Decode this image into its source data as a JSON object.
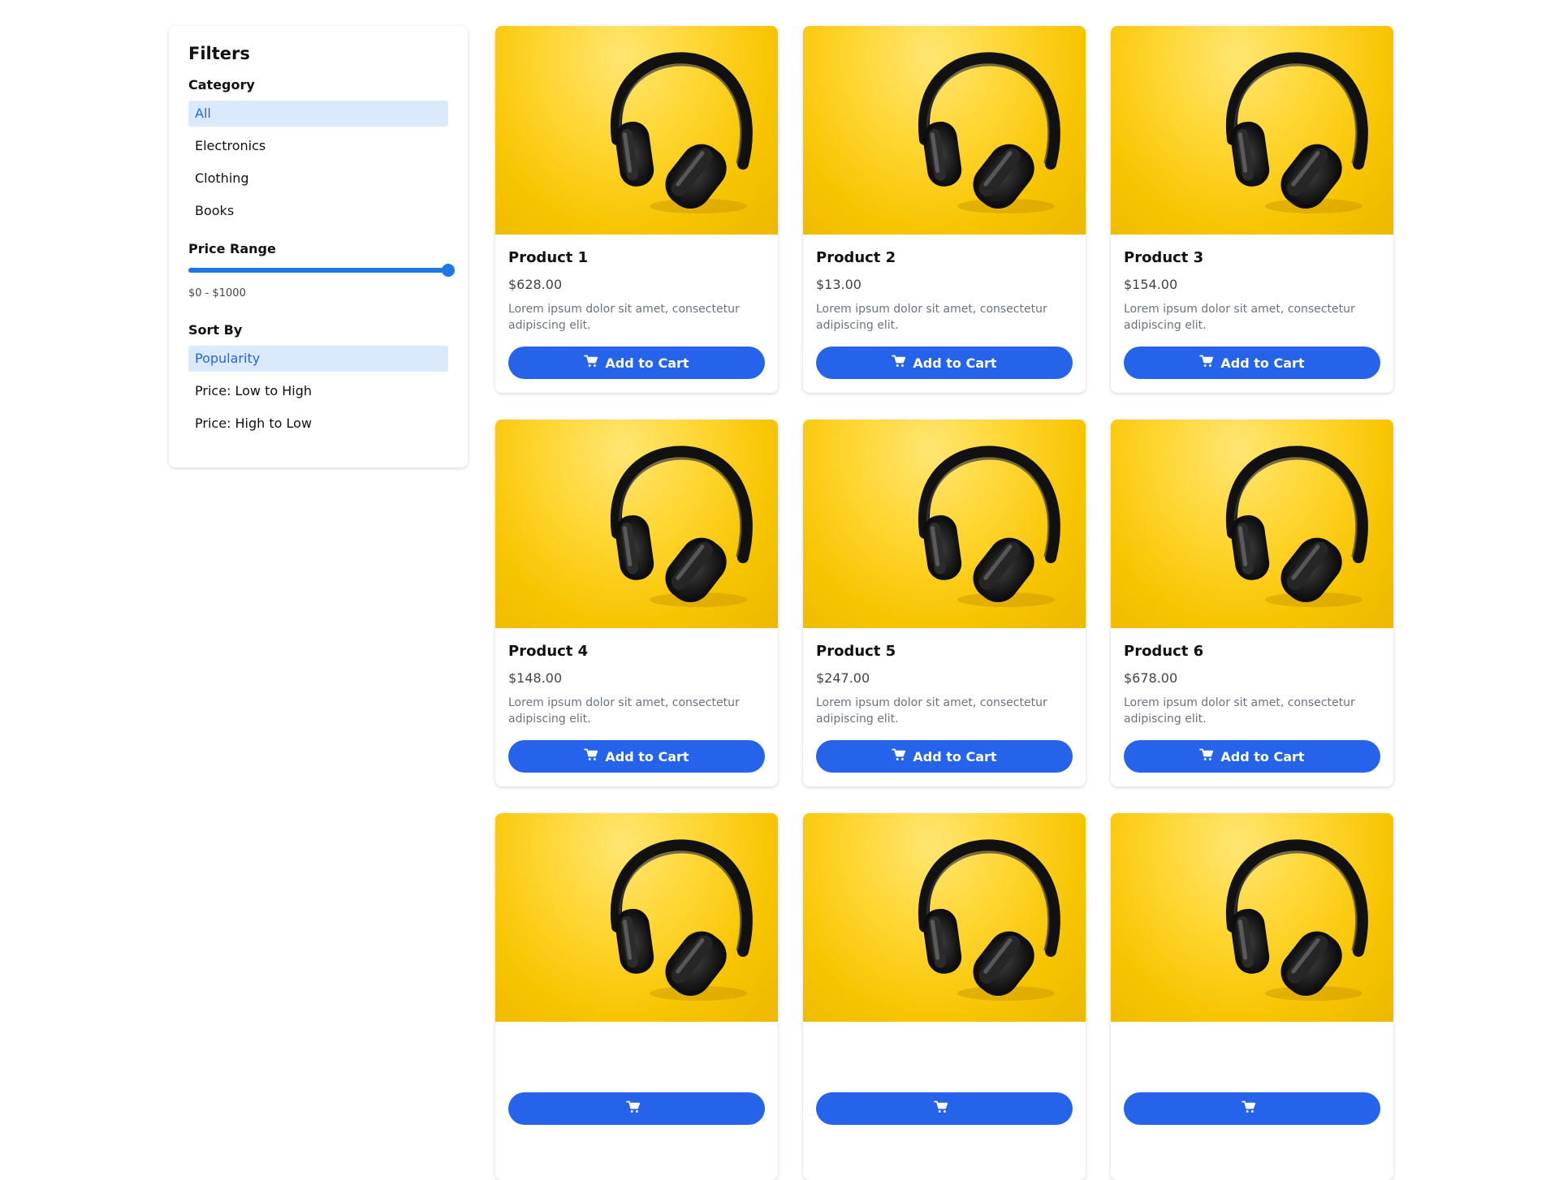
{
  "sidebar": {
    "title": "Filters",
    "category": {
      "title": "Category",
      "options": [
        {
          "label": "All",
          "active": true
        },
        {
          "label": "Electronics",
          "active": false
        },
        {
          "label": "Clothing",
          "active": false
        },
        {
          "label": "Books",
          "active": false
        }
      ]
    },
    "price": {
      "title": "Price Range",
      "min": 0,
      "max": 1000,
      "value_fraction": 1.0,
      "range_text": "$0 - $1000"
    },
    "sort": {
      "title": "Sort By",
      "options": [
        {
          "label": "Popularity",
          "active": true
        },
        {
          "label": "Price: Low to High",
          "active": false
        },
        {
          "label": "Price: High to Low",
          "active": false
        }
      ]
    }
  },
  "products": [
    {
      "title": "Product 1",
      "price": "$628.00",
      "desc": "Lorem ipsum dolor sit amet, consectetur adipiscing elit.",
      "button": "Add to Cart"
    },
    {
      "title": "Product 2",
      "price": "$13.00",
      "desc": "Lorem ipsum dolor sit amet, consectetur adipiscing elit.",
      "button": "Add to Cart"
    },
    {
      "title": "Product 3",
      "price": "$154.00",
      "desc": "Lorem ipsum dolor sit amet, consectetur adipiscing elit.",
      "button": "Add to Cart"
    },
    {
      "title": "Product 4",
      "price": "$148.00",
      "desc": "Lorem ipsum dolor sit amet, consectetur adipiscing elit.",
      "button": "Add to Cart"
    },
    {
      "title": "Product 5",
      "price": "$247.00",
      "desc": "Lorem ipsum dolor sit amet, consectetur adipiscing elit.",
      "button": "Add to Cart"
    },
    {
      "title": "Product 6",
      "price": "$678.00",
      "desc": "Lorem ipsum dolor sit amet, consectetur adipiscing elit.",
      "button": "Add to Cart"
    },
    {
      "title": "",
      "price": "",
      "desc": "",
      "button": ""
    },
    {
      "title": "",
      "price": "",
      "desc": "",
      "button": ""
    },
    {
      "title": "",
      "price": "",
      "desc": "",
      "button": ""
    }
  ],
  "icons": {
    "cart": "shopping-cart-icon",
    "product_image": "headphones-icon"
  },
  "colors": {
    "accent": "#2563eb",
    "slider": "#1d77e8",
    "active_bg": "#dbe9fd",
    "image_bg": "#f7c400"
  }
}
